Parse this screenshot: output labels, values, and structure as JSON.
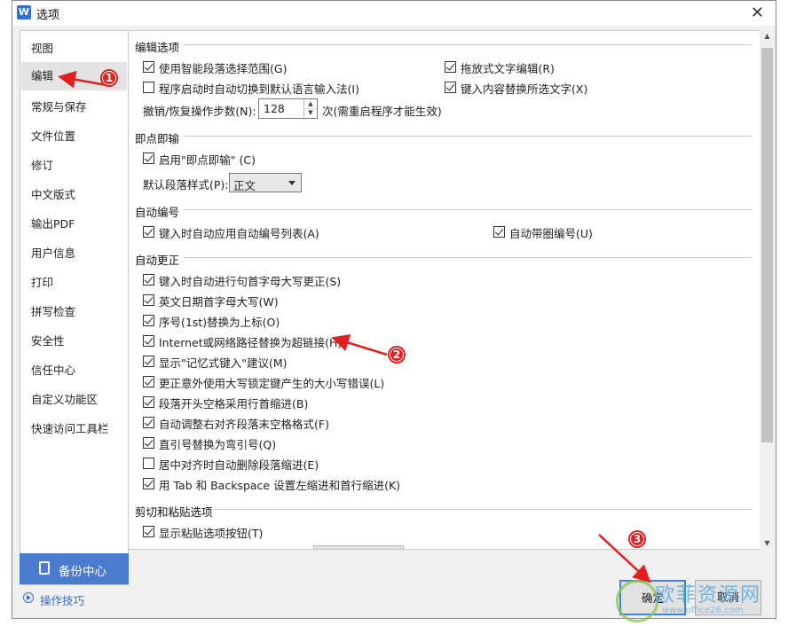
{
  "window": {
    "title": "选项",
    "app_icon": "W",
    "close_glyph": "✕"
  },
  "sidebar": {
    "items": [
      {
        "label": "视图"
      },
      {
        "label": "编辑",
        "active": true
      },
      {
        "label": "常规与保存"
      },
      {
        "label": "文件位置"
      },
      {
        "label": "修订"
      },
      {
        "label": "中文版式"
      },
      {
        "label": "输出PDF"
      },
      {
        "label": "用户信息"
      },
      {
        "label": "打印"
      },
      {
        "label": "拼写检查"
      },
      {
        "label": "安全性"
      },
      {
        "label": "信任中心"
      },
      {
        "label": "自定义功能区"
      },
      {
        "label": "快速访问工具栏"
      }
    ],
    "backup_label": "备份中心",
    "tips_label": "操作技巧"
  },
  "sections": {
    "edit": "编辑选项",
    "click_type": "即点即输",
    "autonumber": "自动编号",
    "autocorrect": "自动更正",
    "cut_paste": "剪切和粘贴选项"
  },
  "edit": {
    "smart_para": {
      "label": "使用智能段落选择范围(G)",
      "checked": true
    },
    "drag_edit": {
      "label": "拖放式文字编辑(R)",
      "checked": true
    },
    "auto_ime": {
      "label": "程序启动时自动切换到默认语言输入法(I)",
      "checked": false
    },
    "type_replace": {
      "label": "键入内容替换所选文字(X)",
      "checked": true
    },
    "undo_label": "撤销/恢复操作步数(N):",
    "undo_value": "128",
    "undo_note": "次(需重启程序才能生效)"
  },
  "click_type": {
    "enable": {
      "label": "启用\"即点即输\" (C)",
      "checked": true
    },
    "default_style_label": "默认段落样式(P):",
    "default_style_value": "正文"
  },
  "autonumber": {
    "list": {
      "label": "键入时自动应用自动编号列表(A)",
      "checked": true
    },
    "circle": {
      "label": "自动带圈编号(U)",
      "checked": true
    }
  },
  "autocorrect": {
    "items": [
      {
        "label": "键入时自动进行句首字母大写更正(S)",
        "checked": true
      },
      {
        "label": "英文日期首字母大写(W)",
        "checked": true
      },
      {
        "label": "序号(1st)替换为上标(O)",
        "checked": true
      },
      {
        "label": "Internet或网络路径替换为超链接(H)",
        "checked": true
      },
      {
        "label": "显示\"记忆式键入\"建议(M)",
        "checked": true
      },
      {
        "label": "更正意外使用大写锁定键产生的大小写错误(L)",
        "checked": true
      },
      {
        "label": "段落开头空格采用行首缩进(B)",
        "checked": true
      },
      {
        "label": "自动调整右对齐段落末空格格式(F)",
        "checked": true
      },
      {
        "label": "直引号替换为弯引号(Q)",
        "checked": true
      },
      {
        "label": "居中对齐时自动删除段落缩进(E)",
        "checked": false
      },
      {
        "label": "用 Tab 和 Backspace 设置左缩进和首行缩进(K)",
        "checked": true
      }
    ]
  },
  "cut_paste": {
    "show_btn": {
      "label": "显示粘贴选项按钮(T)",
      "checked": true
    }
  },
  "buttons": {
    "ok": "确定",
    "cancel": "取消"
  },
  "annotations": [
    "1",
    "2",
    "3"
  ],
  "watermark": {
    "text": "欧菲资源网",
    "url": "www.office26.com"
  },
  "colors": {
    "accent": "#4a7bcc",
    "annotation": "#e02020",
    "link": "#3a6fc4"
  }
}
